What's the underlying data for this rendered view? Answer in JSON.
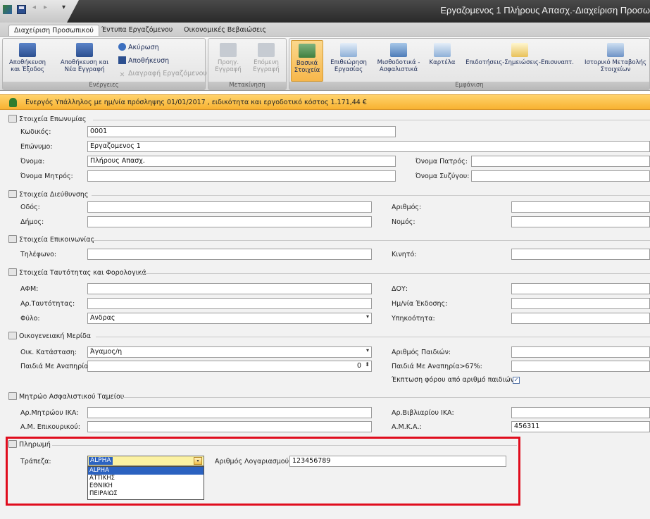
{
  "window": {
    "title": "Εργαζομενος 1 Πλήρους Απασχ.-Διαχείριση Προσω"
  },
  "qat": {
    "undo": "◂",
    "redo": "▸",
    "menu": "▾"
  },
  "ribbon_tabs": [
    "Διαχείριση Προσωπικού",
    "Έντυπα Εργαζόμενου",
    "Οικονομικές Βεβαιώσεις"
  ],
  "ribbon": {
    "groups": {
      "actions": "Ενέργειες",
      "navigation": "Μετακίνηση",
      "view": "Εμφάνιση"
    },
    "save_exit": [
      "Αποθήκευση",
      "και Έξοδος"
    ],
    "save_new": [
      "Αποθήκευση και",
      "Νέα Εγγραφή"
    ],
    "cancel": "Ακύρωση",
    "save": "Αποθήκευση",
    "delete": "Διαγραφή Εργαζόμενου",
    "prev": [
      "Προηγ.",
      "Εγγραφή"
    ],
    "next": [
      "Επόμενη",
      "Εγγραφή"
    ],
    "basic": [
      "Βασικά",
      "Στοιχεία"
    ],
    "work_review": [
      "Επιθεώρηση",
      "Εργασίας"
    ],
    "payroll": [
      "Μισθοδοτικά -",
      "Ασφαλιστικά"
    ],
    "card": "Καρτέλα",
    "allowances": "Επιδοτήσεις-Σημειώσεις-Επισυναπτ.",
    "history": [
      "Ιστορικό Μεταβολής",
      "Στοιχείων"
    ]
  },
  "status": {
    "text": "Ενεργός Υπάλληλος με ημ/νία πρόσληψης 01/01/2017 , ειδικότητα  και εργοδοτικό κόστος 1.171,44 €"
  },
  "sections": {
    "name": {
      "title": "Στοιχεία Επωνυμίας",
      "code_label": "Κωδικός:",
      "code": "0001",
      "surname_label": "Επώνυμο:",
      "surname": "Εργαζομενος 1",
      "firstname_label": "Όνομα:",
      "firstname": "Πλήρους Απασχ.",
      "father_label": "Όνομα Πατρός:",
      "father": "",
      "mother_label": "Όνομα Μητρός:",
      "mother": "",
      "spouse_label": "Όνομα Συζύγου:",
      "spouse": ""
    },
    "address": {
      "title": "Στοιχεία Διεύθυνσης",
      "street_label": "Οδός:",
      "number_label": "Αριθμός:",
      "municipality_label": "Δήμος:",
      "prefecture_label": "Νομός:"
    },
    "contact": {
      "title": "Στοιχεία Επικοινωνίας",
      "phone_label": "Τηλέφωνο:",
      "mobile_label": "Κινητό:"
    },
    "identity": {
      "title": "Στοιχεία Ταυτότητας και Φορολογικά",
      "afm_label": "ΑΦΜ:",
      "doy_label": "ΔΟΥ:",
      "id_label": "Αρ.Ταυτότητας:",
      "issue_label": "Ημ/νία Έκδοσης:",
      "gender_label": "Φύλο:",
      "gender": "Ανδρας",
      "nationality_label": "Υπηκοότητα:"
    },
    "family": {
      "title": "Οικογενειακή Μερίδα",
      "marital_label": "Οικ. Κατάσταση:",
      "marital": "Άγαμος/η",
      "children_label": "Αριθμός Παιδιών:",
      "disabled_label": "Παιδιά Με Αναπηρία:",
      "disabled": "0",
      "disabled67_label": "Παιδιά Με Αναπηρία>67%:",
      "tax_discount_label": "Έκπτωση φόρου από αριθμό παιδιών",
      "tax_discount_check": "✓"
    },
    "insurance": {
      "title": "Μητρώο Ασφαλιστικού Ταμείου",
      "ika_label": "Αρ.Μητρώου ΙΚΑ:",
      "booklet_label": "Αρ.Βιβλιαρίου ΙΚΑ:",
      "aux_label": "Α.Μ. Επικουρικού:",
      "amka_label": "Α.Μ.Κ.Α.:",
      "amka": "456311"
    },
    "payment": {
      "title": "Πληρωμή",
      "bank_label": "Τράπεζα:",
      "bank_value": "ALPHA",
      "account_label": "Αριθμός Λογαριασμού:",
      "account": "123456789",
      "bank_options": [
        "ALPHA",
        "ΑΤΤΙΚΗΣ",
        "ΕΘΝΙΚΗ",
        "ΠΕΙΡΑΙΩΣ"
      ]
    }
  },
  "glyphs": {
    "dropdown": "▾",
    "spin": "⬍",
    "bank_btn": "▾"
  },
  "colors": {
    "highlight_box": "#e00d1e",
    "status_bar": "#f8b231",
    "selection": "#2b62c0"
  }
}
